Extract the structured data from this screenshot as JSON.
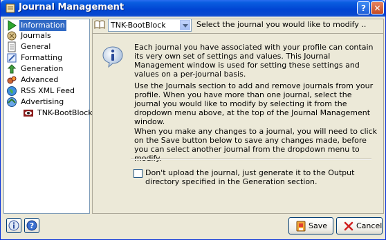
{
  "window": {
    "title": "Journal Management"
  },
  "nav": {
    "items": [
      {
        "label": "Information",
        "icon": "green-arrow-icon"
      },
      {
        "label": "Journals",
        "icon": "journals-icon"
      },
      {
        "label": "General",
        "icon": "document-icon"
      },
      {
        "label": "Formatting",
        "icon": "formatting-icon"
      },
      {
        "label": "Generation",
        "icon": "generation-icon"
      },
      {
        "label": "Advanced",
        "icon": "advanced-icon"
      },
      {
        "label": "RSS XML Feed",
        "icon": "globe-icon"
      },
      {
        "label": "Advertising",
        "icon": "advertising-icon"
      },
      {
        "label": "TNK-BootBlock",
        "icon": "eye-icon"
      }
    ],
    "selected": "Information"
  },
  "journal_select": {
    "value": "TNK-BootBlock",
    "hint": "Select the journal you would like to modify .."
  },
  "info": {
    "p1": "Each journal you have associated with your profile can contain its very own set of settings and values. This Journal Management window is used for setting these settings and values on a per-journal basis.",
    "p2": "Use the Journals section to add and remove journals from your profile. When you have more than one journal, select the journal you would like to modify by selecting it from the dropdown menu above, at the top of the Journal Management window.",
    "p3": "When you make any changes to a journal, you will need to click on the Save button below to save any changes made, before you can select another journal from the dropdown menu to modify."
  },
  "option": {
    "checked": false,
    "label": "Don't upload the journal, just generate it to the Output directory specified in the Generation section."
  },
  "buttons": {
    "save": "Save",
    "cancel": "Cancel"
  },
  "colors": {
    "titlebar": "#0044d2",
    "selection": "#316ac5",
    "face": "#ece9d8"
  }
}
